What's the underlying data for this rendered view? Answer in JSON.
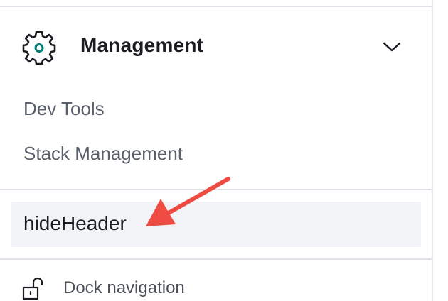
{
  "management_group": {
    "title": "Management",
    "icon": "gear-icon",
    "toggle_icon": "chevron-down-icon",
    "icon_accent_color": "#017d73"
  },
  "links": [
    {
      "label": "Dev Tools"
    },
    {
      "label": "Stack Management"
    }
  ],
  "highlighted_item": {
    "label": "hideHeader",
    "annotation_arrow_color": "#ee4b43"
  },
  "dock": {
    "label": "Dock navigation",
    "icon": "lock-open-icon"
  }
}
